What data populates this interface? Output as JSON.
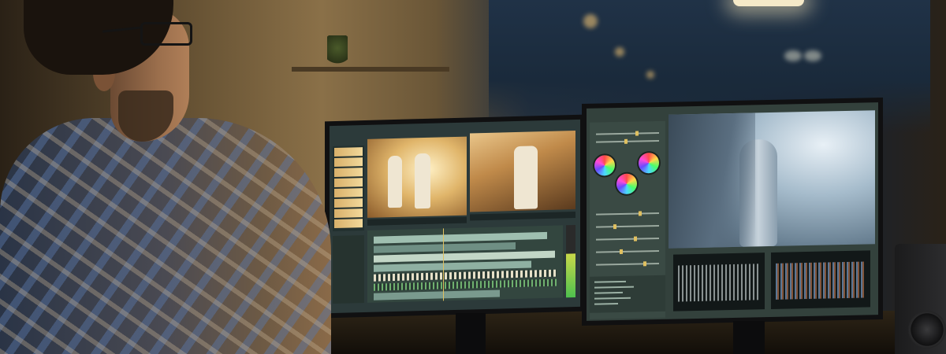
{
  "scene": {
    "subject": "man-at-editing-workstation",
    "palette": {
      "warm_light": "#f0d29a",
      "cool_window": "#1c2a3a",
      "shirt_blue": "#4a5f86",
      "ui_panel": "#2c3a3a"
    }
  },
  "left_monitor": {
    "app": "video-editor",
    "viewer_count": 2,
    "thumbnail_count": 8,
    "timeline_track_count": 7
  },
  "right_monitor": {
    "app": "color-grading",
    "color_wheel_count": 3,
    "slider_count": 7,
    "scope_count": 2
  }
}
